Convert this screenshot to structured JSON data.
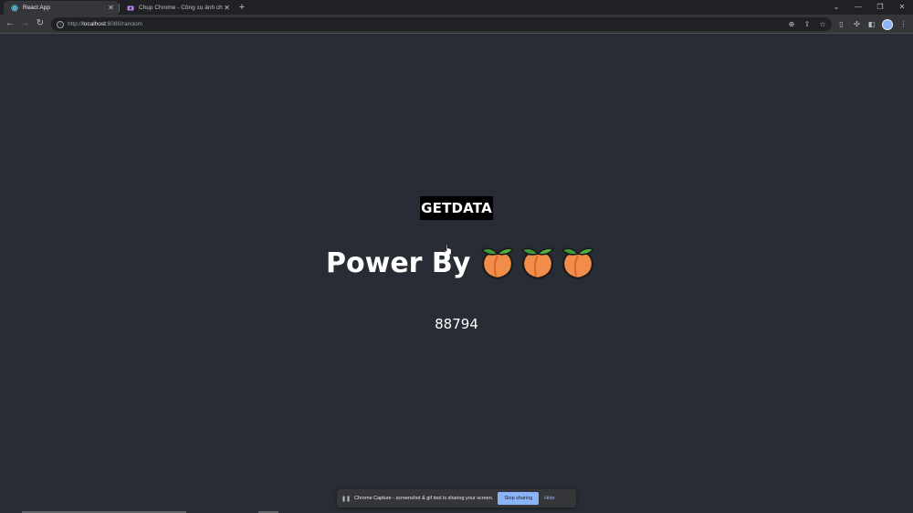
{
  "browser": {
    "tabs": [
      {
        "title": "React App",
        "active": true
      },
      {
        "title": "Chụp Chrome - Công cụ ảnh chụ",
        "active": false
      }
    ],
    "new_tab_label": "+",
    "url": {
      "scheme": "http://",
      "host": "localhost",
      "rest": ":8080/random"
    },
    "window_controls": {
      "tab_search": "⌄",
      "minimize": "—",
      "restore": "❐",
      "close": "✕"
    }
  },
  "app": {
    "button_label": "GETDATA",
    "power_text": "Power By",
    "peach_count": 3,
    "random_value": "88794"
  },
  "sharing_bar": {
    "message": "Chrome Capture - screenshot & gif tool is sharing your screen.",
    "stop_label": "Stop sharing",
    "hide_label": "Hide"
  },
  "colors": {
    "page_bg": "#282c34",
    "button_bg": "#000000",
    "accent": "#8ab4f8"
  }
}
